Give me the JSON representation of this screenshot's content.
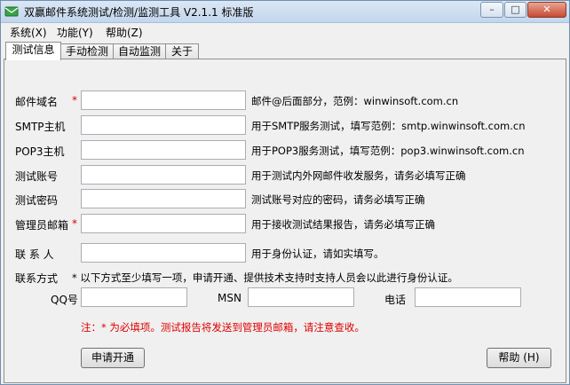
{
  "window": {
    "title": "双赢邮件系统测试/检测/监测工具 V2.1.1 标准版",
    "controls": {
      "minimize": "–",
      "maximize": "□",
      "close": "✕"
    }
  },
  "menu": [
    "系统(X)",
    "功能(Y)",
    "帮助(Z)"
  ],
  "tabs": [
    "测试信息",
    "手动检测",
    "自动监测",
    "关于"
  ],
  "form": {
    "required_mark": "*",
    "rows": [
      {
        "label": "邮件域名",
        "value": "",
        "hint": "邮件@后面部分，范例：winwinsoft.com.cn"
      },
      {
        "label": "SMTP主机",
        "value": "",
        "hint": "用于SMTP服务测试，填写范例：smtp.winwinsoft.com.cn"
      },
      {
        "label": "POP3主机",
        "value": "",
        "hint": "用于POP3服务测试，填写范例：pop3.winwinsoft.com.cn"
      },
      {
        "label": "测试账号",
        "value": "",
        "hint": "用于测试内外网邮件收发服务，请务必填写正确"
      },
      {
        "label": "测试密码",
        "value": "",
        "hint": "测试账号对应的密码，请务必填写正确"
      },
      {
        "label": "管理员邮箱",
        "value": "",
        "hint": "用于接收测试结果报告，请务必填写正确"
      },
      {
        "label": "联 系 人",
        "value": "",
        "hint": "用于身份认证，请如实填写。"
      }
    ],
    "contact": {
      "label": "联系方式",
      "note": "* 以下方式至少填写一项，申请开通、提供技术支持时支持人员会以此进行身份认证。",
      "qq_label": "QQ号",
      "msn_label": "MSN",
      "phone_label": "电话",
      "qq_value": "",
      "msn_value": "",
      "phone_value": ""
    },
    "footnote": "注：* 为必填项。测试报告将发送到管理员邮箱，请注意查收。"
  },
  "buttons": {
    "apply": "申请开通",
    "help": "帮助 (H)"
  },
  "colors": {
    "required": "#e00000",
    "titlebar": "#c3d6ec"
  }
}
